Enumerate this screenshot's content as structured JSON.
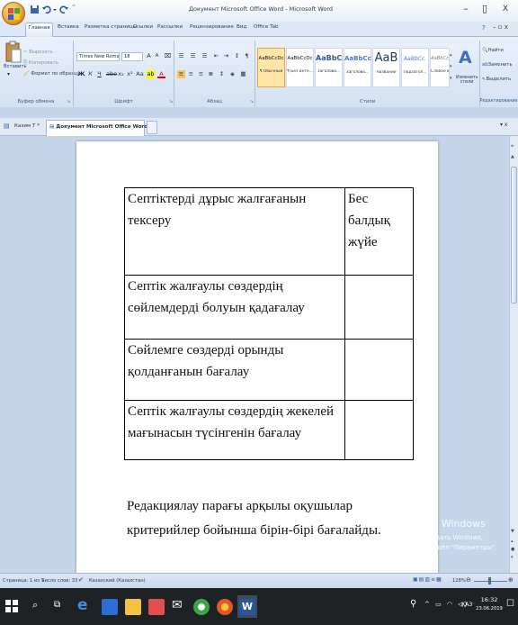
{
  "window": {
    "title": "Документ Microsoft Office Word - Microsoft Word",
    "minimize": "–",
    "restore": "▯",
    "close": "X"
  },
  "ribbon_tabs": [
    "Главная",
    "Вставка",
    "Разметка страницы",
    "Ссылки",
    "Рассылки",
    "Рецензирование",
    "Вид",
    "Office Tab"
  ],
  "clipboard": {
    "paste": "Вставить",
    "cut": "Вырезать",
    "copy": "Копировать",
    "format_painter": "Формат по образцу",
    "label": "Буфер обмена"
  },
  "font": {
    "name": "Times New Roman",
    "size": "18",
    "label": "Шрифт"
  },
  "paragraph": {
    "label": "Абзац"
  },
  "styles": {
    "label": "Стили",
    "change_styles": "Изменить стили",
    "items": [
      {
        "sample": "AaBbCcDc",
        "name": "¶ Обычный"
      },
      {
        "sample": "AaBbCcDc",
        "name": "¶ Без инте..."
      },
      {
        "sample": "AaBbC",
        "name": "Заголово..."
      },
      {
        "sample": "AaBbCc",
        "name": "Заголово..."
      },
      {
        "sample": "AaB",
        "name": "Название"
      },
      {
        "sample": "AaBbCc.",
        "name": "Подзагол..."
      },
      {
        "sample": "AaBbCcDt",
        "name": "Слабое в..."
      }
    ]
  },
  "editing": {
    "find": "Найти",
    "replace": "Заменить",
    "select": "Выделить",
    "label": "Редактирование"
  },
  "doc_tabs": [
    {
      "label": "Казим Т *"
    },
    {
      "label": "Документ Microsoft Office Word *"
    }
  ],
  "table": {
    "header": [
      "Септіктерді дұрыс жалғағанын тексеру",
      "Бес балдық жүйе"
    ],
    "rows": [
      [
        "Септік жалғаулы сөздердің сөйлемдерді болуын қадағалау",
        ""
      ],
      [
        "Сөйлемге сөздерді орынды қолданғанын бағалау",
        ""
      ],
      [
        "Септік жалғаулы сөздердің жекелей мағынасын түсінгенін бағалау",
        ""
      ]
    ]
  },
  "paragraph_text": "Редакциялау парағы арқылы оқушылар критерийлер бойынша бірін-бірі бағалайды.",
  "activation": {
    "title": "Активация Windows",
    "subtitle": "Чтобы активировать Windows, перейдите в раздел \"Параметры\"."
  },
  "status": {
    "page": "Страница: 1 из 1",
    "words": "Число слов: 33",
    "language": "Казахский (Казахстан)",
    "zoom": "128%"
  },
  "taskbar": {
    "language": "ҚАЗ",
    "time": "16:32",
    "date": "23.06.2019"
  }
}
